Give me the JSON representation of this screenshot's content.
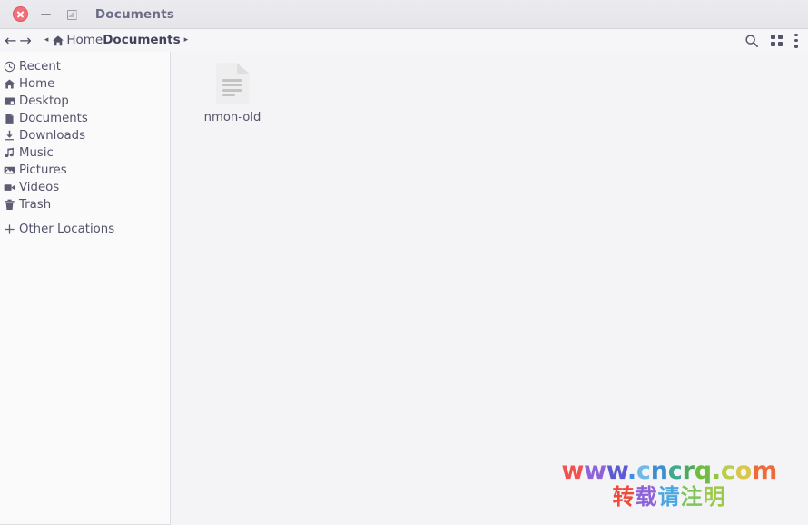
{
  "window": {
    "title": "Documents",
    "controls": {
      "close_label": "close-icon",
      "minimize_label": "minimize-icon",
      "maximize_label": "maximize-icon"
    }
  },
  "pathbar": {
    "back_glyph": "←",
    "forward_glyph": "→",
    "left_caret": "◂",
    "right_caret": "▸",
    "crumbs": [
      {
        "label": "Home",
        "current": false
      },
      {
        "label": "Documents",
        "current": true
      }
    ],
    "tools": {
      "search_label": "search-icon",
      "view_grid_label": "view-grid-icon",
      "menu_label": "more-options-icon"
    }
  },
  "sidebar": {
    "items": [
      {
        "label": "Recent",
        "icon": "clock-icon"
      },
      {
        "label": "Home",
        "icon": "home-icon"
      },
      {
        "label": "Desktop",
        "icon": "desktop-icon"
      },
      {
        "label": "Documents",
        "icon": "document-icon"
      },
      {
        "label": "Downloads",
        "icon": "download-icon"
      },
      {
        "label": "Music",
        "icon": "music-note-icon"
      },
      {
        "label": "Pictures",
        "icon": "picture-icon"
      },
      {
        "label": "Videos",
        "icon": "video-camera-icon"
      },
      {
        "label": "Trash",
        "icon": "trash-icon"
      }
    ],
    "other_locations": {
      "label": "Other Locations",
      "icon": "plus-icon"
    }
  },
  "files": [
    {
      "name": "nmon-old",
      "icon": "text-document-icon"
    }
  ],
  "watermark": {
    "line1": [
      {
        "t": "w",
        "c": "#ef5350"
      },
      {
        "t": "w",
        "c": "#8e63d8"
      },
      {
        "t": "w",
        "c": "#5b5bd6"
      },
      {
        "t": ".",
        "c": "#3d8ee8"
      },
      {
        "t": "c",
        "c": "#6fb9e8"
      },
      {
        "t": "n",
        "c": "#3f8fd0"
      },
      {
        "t": "c",
        "c": "#3fa98f"
      },
      {
        "t": "r",
        "c": "#4aab5c"
      },
      {
        "t": "q",
        "c": "#6fbc3e"
      },
      {
        "t": ".",
        "c": "#8fc63d"
      },
      {
        "t": "c",
        "c": "#b9cf4a"
      },
      {
        "t": "o",
        "c": "#d8c74a"
      },
      {
        "t": "m",
        "c": "#ef6a3a"
      }
    ],
    "line2": [
      {
        "t": "转",
        "c": "#ef4a3a"
      },
      {
        "t": "载",
        "c": "#8e63d8"
      },
      {
        "t": "请",
        "c": "#4aa7e0"
      },
      {
        "t": "注",
        "c": "#7fc55a"
      },
      {
        "t": "明",
        "c": "#9dc94a"
      }
    ]
  }
}
